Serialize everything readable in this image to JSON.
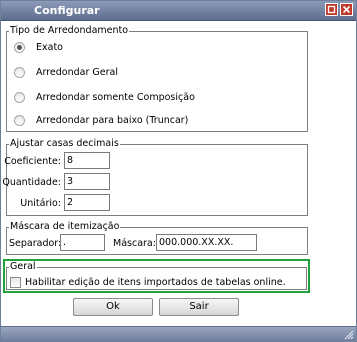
{
  "window": {
    "title": "Configurar",
    "minimize_icon": "minimize-icon",
    "close_icon": "close-icon"
  },
  "rounding": {
    "legend": "Tipo de Arredondamento",
    "options": [
      {
        "label": "Exato",
        "selected": true
      },
      {
        "label": "Arredondar Geral",
        "selected": false
      },
      {
        "label": "Arredondar somente Composição",
        "selected": false
      },
      {
        "label": "Arredondar para baixo (Truncar)",
        "selected": false
      }
    ]
  },
  "decimals": {
    "legend": "Ajustar casas decimais",
    "coeficiente_label": "Coeficiente:",
    "coeficiente_value": "8",
    "quantidade_label": "Quantidade:",
    "quantidade_value": "3",
    "unitario_label": "Unitário:",
    "unitario_value": "2"
  },
  "mask": {
    "legend": "Máscara de itemização",
    "separator_label": "Separador:",
    "separator_value": ".",
    "mask_label": "Máscara:",
    "mask_value": "000.000.XX.XX."
  },
  "general": {
    "legend": "Geral",
    "checkbox_label": "Habilitar edição de itens importados de tabelas online.",
    "checked": false
  },
  "buttons": {
    "ok": "Ok",
    "exit": "Sair"
  },
  "colors": {
    "highlight_border": "#22a23a",
    "titlebar": "#6f7f9f",
    "close_button": "#c0392b"
  }
}
